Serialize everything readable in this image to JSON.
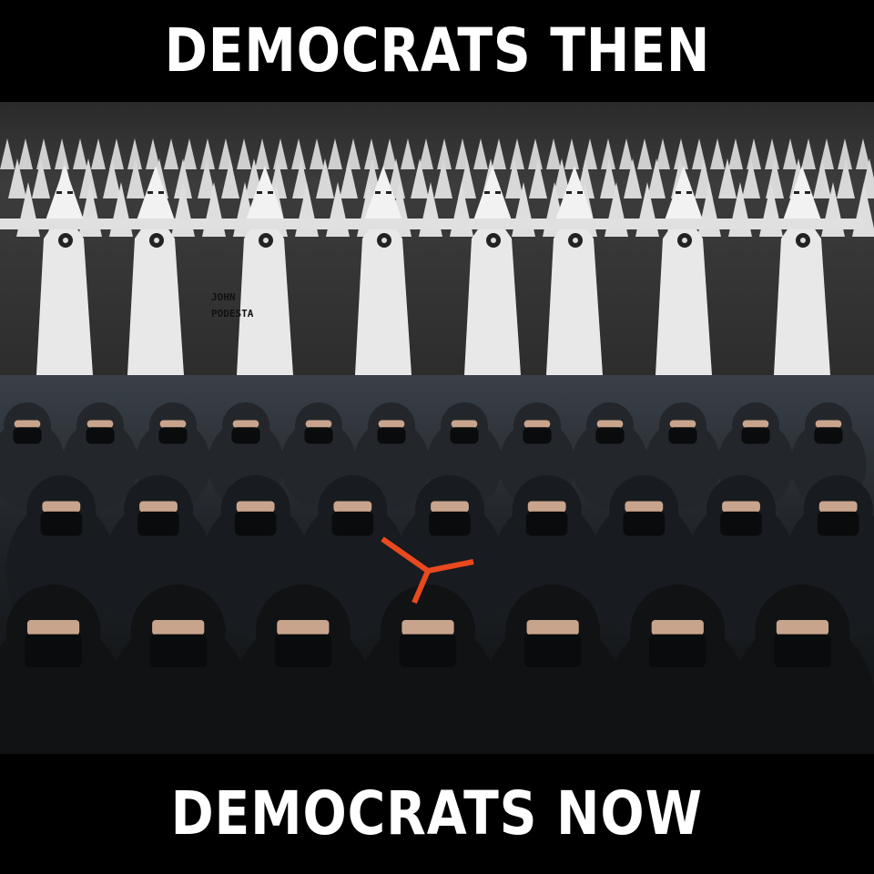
{
  "top_caption": "DEMOCRATS THEN",
  "bottom_caption": "DEMOCRATS NOW",
  "photo_top_overlay": {
    "line1": "JOHN",
    "line2": "PODESTA"
  },
  "colors": {
    "background": "#000000",
    "caption_text": "#ffffff",
    "robe": "#e8e8e8",
    "dark_clothing": "#101214",
    "vest_strap": "#e8491f"
  }
}
